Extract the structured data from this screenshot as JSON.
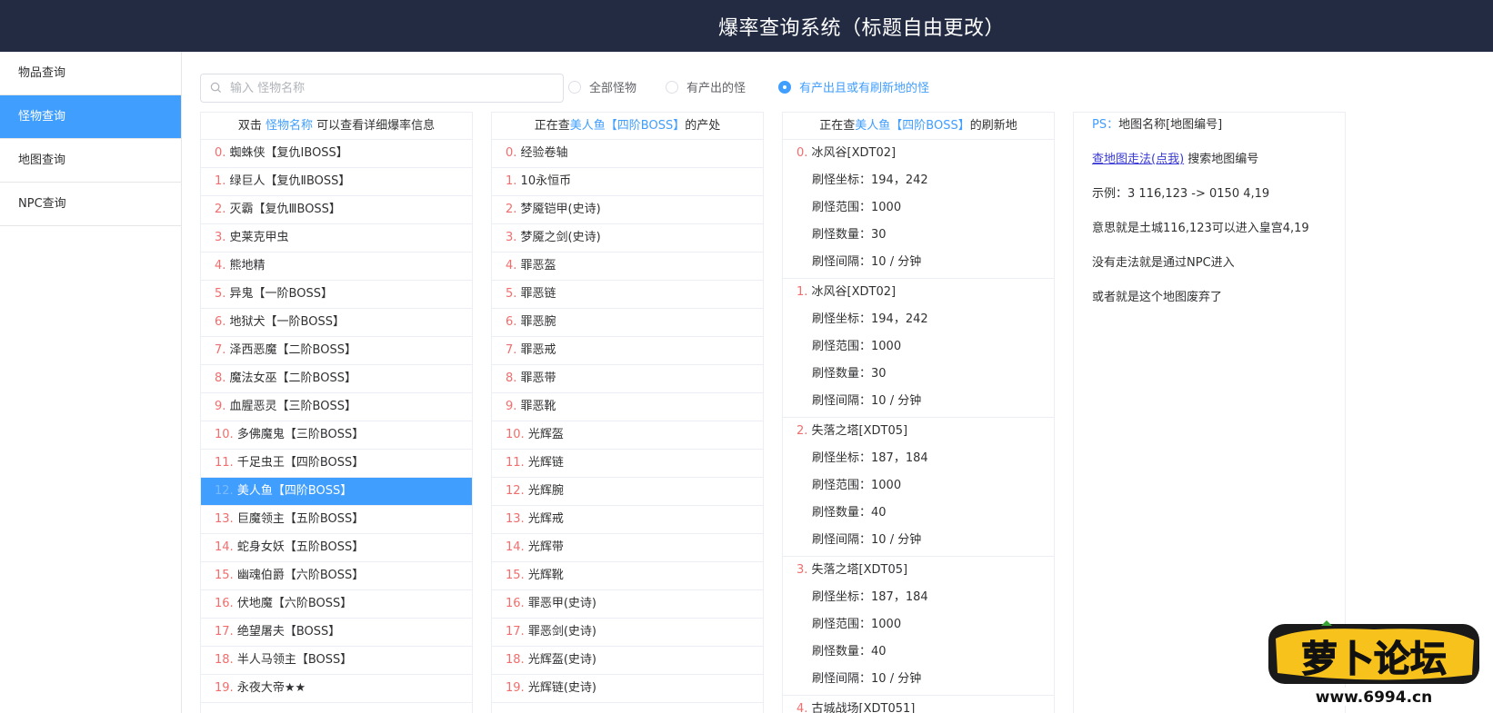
{
  "header": {
    "title": "爆率查询系统（标题自由更改）"
  },
  "sidebar": {
    "items": [
      {
        "label": "物品查询"
      },
      {
        "label": "怪物查询"
      },
      {
        "label": "地图查询"
      },
      {
        "label": "NPC查询"
      }
    ]
  },
  "search": {
    "placeholder": "输入 怪物名称",
    "value": ""
  },
  "filters": [
    {
      "label": "全部怪物",
      "checked": false
    },
    {
      "label": "有产出的怪",
      "checked": false
    },
    {
      "label": "有产出且或有刷新地的怪",
      "checked": true
    }
  ],
  "monster_panel": {
    "header_pre": "双击 ",
    "header_hl": "怪物名称",
    "header_post": " 可以查看详细爆率信息",
    "rows": [
      {
        "idx": "0.",
        "name": "蜘蛛侠【复仇ⅠBOSS】"
      },
      {
        "idx": "1.",
        "name": "绿巨人【复仇ⅡBOSS】"
      },
      {
        "idx": "2.",
        "name": "灭霸【复仇ⅢBOSS】"
      },
      {
        "idx": "3.",
        "name": "史莱克甲虫"
      },
      {
        "idx": "4.",
        "name": "熊地精"
      },
      {
        "idx": "5.",
        "name": "异鬼【一阶BOSS】"
      },
      {
        "idx": "6.",
        "name": "地狱犬【一阶BOSS】"
      },
      {
        "idx": "7.",
        "name": "泽西恶魔【二阶BOSS】"
      },
      {
        "idx": "8.",
        "name": "魔法女巫【二阶BOSS】"
      },
      {
        "idx": "9.",
        "name": "血腥恶灵【三阶BOSS】"
      },
      {
        "idx": "10.",
        "name": "多佛魔鬼【三阶BOSS】"
      },
      {
        "idx": "11.",
        "name": "千足虫王【四阶BOSS】"
      },
      {
        "idx": "12.",
        "name": "美人鱼【四阶BOSS】"
      },
      {
        "idx": "13.",
        "name": "巨魔领主【五阶BOSS】"
      },
      {
        "idx": "14.",
        "name": "蛇身女妖【五阶BOSS】"
      },
      {
        "idx": "15.",
        "name": "幽魂伯爵【六阶BOSS】"
      },
      {
        "idx": "16.",
        "name": "伏地魔【六阶BOSS】"
      },
      {
        "idx": "17.",
        "name": "绝望屠夫【BOSS】"
      },
      {
        "idx": "18.",
        "name": "半人马领主【BOSS】"
      },
      {
        "idx": "19.",
        "name": "永夜大帝★★"
      }
    ]
  },
  "drops_panel": {
    "header_pre": "正在查",
    "header_hl": "美人鱼【四阶BOSS】",
    "header_post": "的产处",
    "rows": [
      {
        "idx": "0.",
        "name": "经验卷轴"
      },
      {
        "idx": "1.",
        "name": "10永恒币"
      },
      {
        "idx": "2.",
        "name": "梦魇铠甲(史诗)"
      },
      {
        "idx": "3.",
        "name": "梦魇之剑(史诗)"
      },
      {
        "idx": "4.",
        "name": "罪恶盔"
      },
      {
        "idx": "5.",
        "name": "罪恶链"
      },
      {
        "idx": "6.",
        "name": "罪恶腕"
      },
      {
        "idx": "7.",
        "name": "罪恶戒"
      },
      {
        "idx": "8.",
        "name": "罪恶带"
      },
      {
        "idx": "9.",
        "name": "罪恶靴"
      },
      {
        "idx": "10.",
        "name": "光辉盔"
      },
      {
        "idx": "11.",
        "name": "光辉链"
      },
      {
        "idx": "12.",
        "name": "光辉腕"
      },
      {
        "idx": "13.",
        "name": "光辉戒"
      },
      {
        "idx": "14.",
        "name": "光辉带"
      },
      {
        "idx": "15.",
        "name": "光辉靴"
      },
      {
        "idx": "16.",
        "name": "罪恶甲(史诗)"
      },
      {
        "idx": "17.",
        "name": "罪恶剑(史诗)"
      },
      {
        "idx": "18.",
        "name": "光辉盔(史诗)"
      },
      {
        "idx": "19.",
        "name": "光辉链(史诗)"
      }
    ]
  },
  "spawn_panel": {
    "header_pre": "正在查",
    "header_hl": "美人鱼【四阶BOSS】",
    "header_post": "的刷新地",
    "label_coord": "刷怪坐标：",
    "label_range": "刷怪范围：",
    "label_count": "刷怪数量：",
    "label_interval": "刷怪间隔：",
    "locations": [
      {
        "idx": "0.",
        "name": "冰风谷[XDT02]",
        "coord": "194，242",
        "range": "1000",
        "count": "30",
        "interval": "10 / 分钟"
      },
      {
        "idx": "1.",
        "name": "冰风谷[XDT02]",
        "coord": "194，242",
        "range": "1000",
        "count": "30",
        "interval": "10 / 分钟"
      },
      {
        "idx": "2.",
        "name": "失落之塔[XDT05]",
        "coord": "187，184",
        "range": "1000",
        "count": "40",
        "interval": "10 / 分钟"
      },
      {
        "idx": "3.",
        "name": "失落之塔[XDT05]",
        "coord": "187，184",
        "range": "1000",
        "count": "40",
        "interval": "10 / 分钟"
      },
      {
        "idx": "4.",
        "name": "古城战场[XDT051]"
      }
    ]
  },
  "info_panel": {
    "ps_label": "PS：",
    "ps_text": "地图名称[地图编号]",
    "link_text": "查地图走法(点我)",
    "link_suffix": " 搜索地图编号",
    "example": "示例：3 116,123 -> 0150 4,19",
    "meaning": "意思就是土城116,123可以进入皇宫4,19",
    "no_path": "没有走法就是通过NPC进入",
    "abandoned": "或者就是这个地图废弃了"
  },
  "watermark": {
    "brand": "萝卜论坛",
    "url": "www.6994.cn"
  },
  "colors": {
    "header_bg": "#232b43",
    "accent": "#409eff",
    "index_red": "#f56c6c"
  }
}
